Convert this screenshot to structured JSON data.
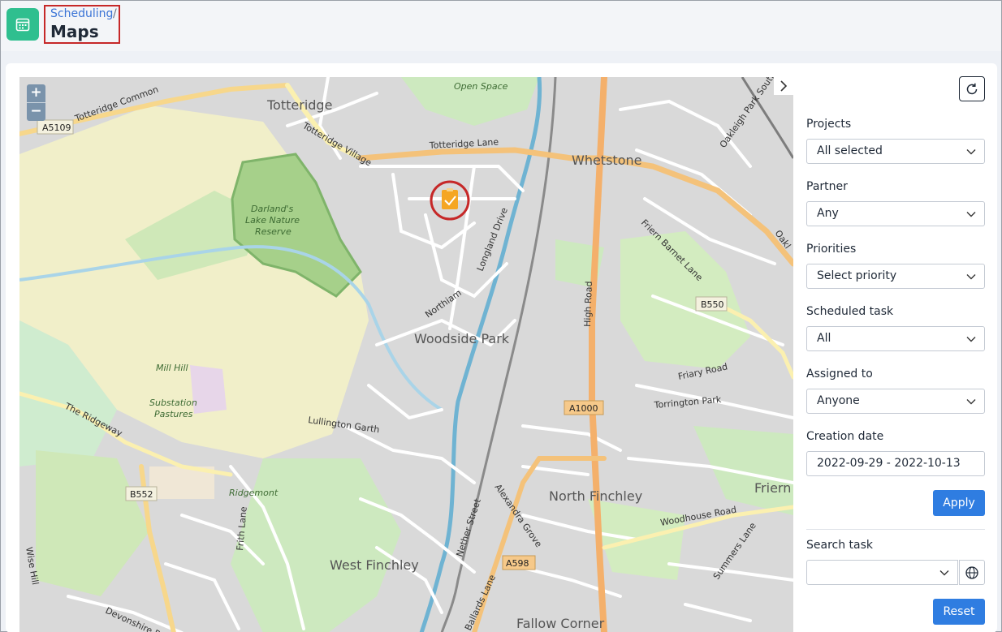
{
  "header": {
    "breadcrumb_parent": "Scheduling",
    "breadcrumb_separator": "/",
    "page_title": "Maps",
    "app_icon": "calendar-icon"
  },
  "map": {
    "zoom_in_label": "+",
    "zoom_out_label": "−",
    "marker_icon": "task-clipboard-check-icon",
    "labels": {
      "totteridge": "Totteridge",
      "totteridge_common": "Totteridge Common",
      "a5109": "A5109",
      "totteridge_village": "Totteridge Village",
      "totteridge_lane": "Totteridge Lane",
      "whetstone": "Whetstone",
      "oakleigh_park_south": "Oakleigh Park South",
      "oakl": "Oakl",
      "darlands_1": "Darland's",
      "darlands_2": "Lake Nature",
      "darlands_3": "Reserve",
      "green_open_space": "Open Space",
      "longland_drive": "Longland Drive",
      "friern_barnet_lane": "Friern Barnet Lane",
      "b550": "B550",
      "high_road": "High Road",
      "northiam": "Northiam",
      "woodside_park": "Woodside Park",
      "friary_road": "Friary Road",
      "torrington_park": "Torrington Park",
      "a1000": "A1000",
      "mill_hill_1": "Mill Hill",
      "mill_hill_2": "Substation",
      "mill_hill_3": "Pastures",
      "the_ridgeway": "The Ridgeway",
      "lullington_garth": "Lullington Garth",
      "b552": "B552",
      "ridgemont": "Ridgemont",
      "frith_lane": "Frith Lane",
      "nether_street": "Nether Street",
      "alexandra_grove": "Alexandra Grove",
      "north_finchley": "North Finchley",
      "friern": "Friern",
      "woodhouse_road": "Woodhouse Road",
      "summers_lane": "Summers Lane",
      "a598": "A598",
      "west_finchley": "West Finchley",
      "wise_hill": "Wise Hill",
      "devonshire_road": "Devonshire Road",
      "ballards_lane": "Ballards Lane",
      "fallow_corner": "Fallow Corner"
    }
  },
  "filters": {
    "projects": {
      "label": "Projects",
      "value": "All selected"
    },
    "partner": {
      "label": "Partner",
      "value": "Any"
    },
    "priorities": {
      "label": "Priorities",
      "value": "Select priority"
    },
    "scheduled_task": {
      "label": "Scheduled task",
      "value": "All"
    },
    "assigned_to": {
      "label": "Assigned to",
      "value": "Anyone"
    },
    "creation_date": {
      "label": "Creation date",
      "value": "2022-09-29 - 2022-10-13"
    },
    "apply_label": "Apply",
    "search_task": {
      "label": "Search task",
      "value": ""
    },
    "reset_label": "Reset"
  },
  "colors": {
    "accent": "#2f7de1",
    "app_icon_bg": "#2fbf8f",
    "highlight": "#c62828",
    "marker": "#f5a623"
  }
}
